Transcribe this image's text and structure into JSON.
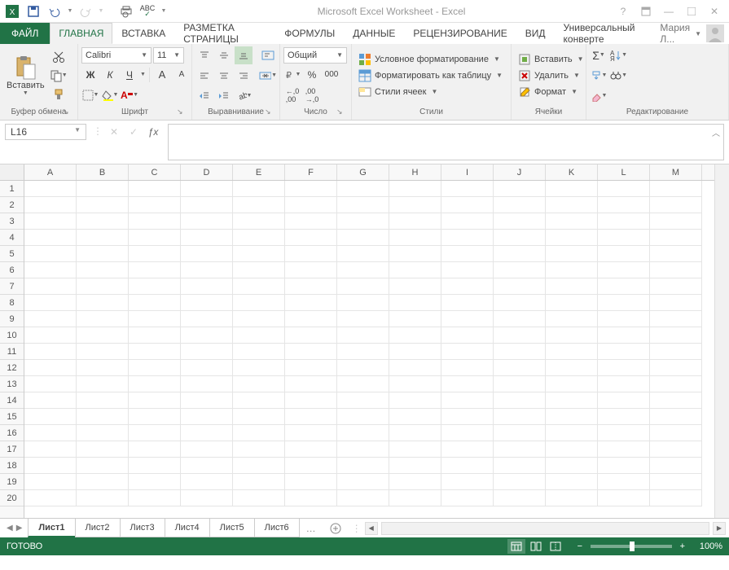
{
  "title": "Microsoft Excel Worksheet - Excel",
  "user": "Мария Л...",
  "tabs": {
    "file": "ФАЙЛ",
    "items": [
      "ГЛАВНАЯ",
      "ВСТАВКА",
      "РАЗМЕТКА СТРАНИЦЫ",
      "ФОРМУЛЫ",
      "ДАННЫЕ",
      "РЕЦЕНЗИРОВАНИЕ",
      "ВИД",
      "Универсальный конверте"
    ],
    "active": 0
  },
  "ribbon": {
    "clipboard": {
      "paste": "Вставить",
      "label": "Буфер обмена"
    },
    "font": {
      "name": "Calibri",
      "size": "11",
      "bold": "Ж",
      "italic": "К",
      "underline": "Ч",
      "label": "Шрифт"
    },
    "alignment": {
      "label": "Выравнивание"
    },
    "number": {
      "format": "Общий",
      "label": "Число"
    },
    "styles": {
      "cond": "Условное форматирование",
      "table": "Форматировать как таблицу",
      "cell": "Стили ячеек",
      "label": "Стили"
    },
    "cells": {
      "insert": "Вставить",
      "delete": "Удалить",
      "format": "Формат",
      "label": "Ячейки"
    },
    "editing": {
      "label": "Редактирование"
    }
  },
  "formula": {
    "namebox": "L16",
    "value": ""
  },
  "grid": {
    "columns": [
      "A",
      "B",
      "C",
      "D",
      "E",
      "F",
      "G",
      "H",
      "I",
      "J",
      "K",
      "L",
      "M"
    ],
    "rows": [
      1,
      2,
      3,
      4,
      5,
      6,
      7,
      8,
      9,
      10,
      11,
      12,
      13,
      14,
      15,
      16,
      17,
      18,
      19,
      20
    ]
  },
  "sheets": {
    "items": [
      "Лист1",
      "Лист2",
      "Лист3",
      "Лист4",
      "Лист5",
      "Лист6"
    ],
    "active": 0
  },
  "status": {
    "ready": "ГОТОВО",
    "zoom": "100%"
  }
}
